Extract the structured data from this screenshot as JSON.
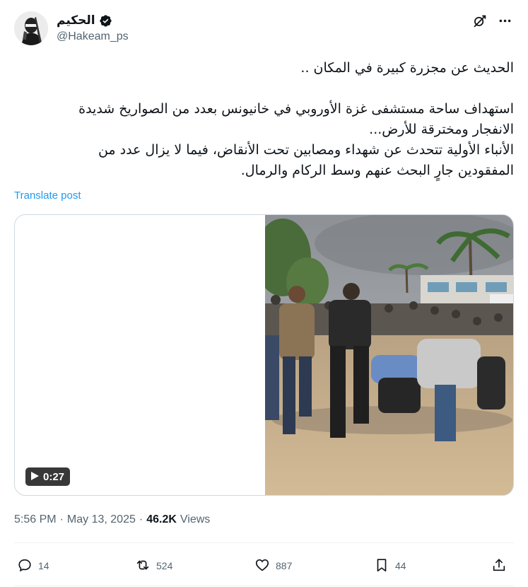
{
  "author": {
    "display_name": "الحكيم",
    "handle": "@Hakeam_ps"
  },
  "tweet": {
    "paragraph_1": "الحديث عن مجزرة كبيرة في المكان ..",
    "paragraph_2_line_1": "استهداف ساحة مستشفى غزة الأوروبي في خانيونس بعدد من الصواريخ شديدة",
    "paragraph_2_line_2": "الانفجار ومخترقة للأرض...",
    "paragraph_2_line_3": "الأنباء الأولية تتحدث عن شهداء ومصابين تحت الأنقاض، فيما لا يزال عدد من",
    "paragraph_2_line_4": "المفقودين جارٍ البحث عنهم وسط الركام والرمال."
  },
  "translate_label": "Translate post",
  "media": {
    "duration": "0:27"
  },
  "meta": {
    "time": "5:56 PM",
    "separator": "·",
    "date": "May 13, 2025",
    "views_count": "46.2K",
    "views_label": "Views"
  },
  "actions": {
    "replies": "14",
    "reposts": "524",
    "likes": "887",
    "bookmarks": "44"
  },
  "colors": {
    "accent": "#1d9bf0",
    "secondary_text": "#536471",
    "primary_text": "#0f1419"
  },
  "icons": [
    "verified-badge-icon",
    "grok-icon",
    "more-icon",
    "play-icon",
    "reply-icon",
    "repost-icon",
    "like-icon",
    "bookmark-icon",
    "share-icon"
  ]
}
